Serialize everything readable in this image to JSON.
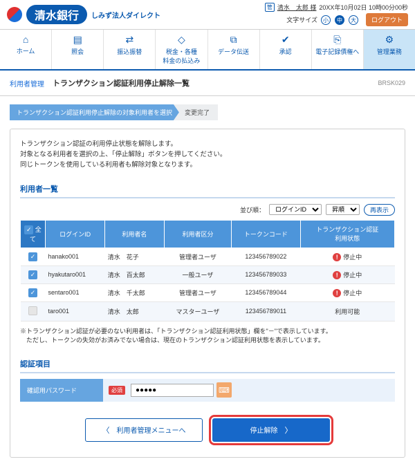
{
  "header": {
    "bank_name": "清水銀行",
    "bank_sub": "しみず法人ダイレクト",
    "mgmt_badge": "管",
    "user_name": "清水　太郎 様",
    "datetime": "20XX年10月02日 10時00分00秒",
    "font_size_label": "文字サイズ",
    "size_s": "小",
    "size_m": "中",
    "size_l": "大",
    "logout": "ログアウト"
  },
  "nav": {
    "home": "ホーム",
    "inquiry": "照会",
    "transfer": "振込振替",
    "tax": "税金・各種\n料金の払込み",
    "data": "データ伝送",
    "approve": "承認",
    "edoc": "電子記録債権へ",
    "admin": "管理業務"
  },
  "crumb": {
    "category": "利用者管理",
    "title": "トランザクション認証利用停止解除一覧",
    "code": "BRSK029"
  },
  "steps": {
    "s1": "トランザクション認証利用停止解除の対象利用者を選択",
    "s2": "変更完了"
  },
  "intro": {
    "l1": "トランザクション認証の利用停止状態を解除します。",
    "l2": "対象となる利用者を選択の上、「停止解除」ボタンを押してください。",
    "l3": "同じトークンを使用している利用者も解除対象となります。"
  },
  "section_users": "利用者一覧",
  "sort": {
    "label": "並び順：",
    "field": "ログインID",
    "order": "昇順",
    "refresh": "再表示"
  },
  "cols": {
    "all": "全て",
    "login": "ログインID",
    "name": "利用者名",
    "role": "利用者区分",
    "token": "トークンコード",
    "status": "トランザクション認証\n利用状態"
  },
  "rows": [
    {
      "checked": true,
      "login": "hanako001",
      "name": "清水　花子",
      "role": "管理者ユーザ",
      "token": "123456789022",
      "status": "停止中",
      "warn": true
    },
    {
      "checked": true,
      "login": "hyakutaro001",
      "name": "清水　百太郎",
      "role": "一般ユーザ",
      "token": "123456789033",
      "status": "停止中",
      "warn": true
    },
    {
      "checked": true,
      "login": "sentaro001",
      "name": "清水　千太郎",
      "role": "管理者ユーザ",
      "token": "123456789044",
      "status": "停止中",
      "warn": true
    },
    {
      "checked": false,
      "disabled": true,
      "login": "taro001",
      "name": "清水　太郎",
      "role": "マスターユーザ",
      "token": "123456789011",
      "status": "利用可能",
      "warn": false
    }
  ],
  "note": {
    "l1": "※トランザクション認証が必要のない利用者は、「トランザクション認証利用状態」欄を\"－\"で表示しています。",
    "l2": "　ただし、トークンの失効がお済みでない場合は、現在のトランザクション認証利用状態を表示しています。"
  },
  "section_auth": "認証項目",
  "auth": {
    "label": "確認用パスワード",
    "required": "必須",
    "value": "●●●●●"
  },
  "buttons": {
    "back": "利用者管理メニューへ",
    "submit": "停止解除"
  }
}
